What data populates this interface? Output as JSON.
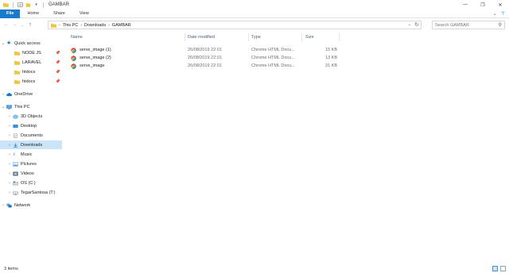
{
  "window": {
    "title": "GAMBAR",
    "controls": [
      "—",
      "❐",
      "✕"
    ]
  },
  "ribbon": {
    "tabs": [
      "File",
      "Home",
      "Share",
      "View"
    ],
    "expand_glyph": "⌄",
    "help_glyph": "?"
  },
  "address": {
    "crumbs": [
      "This PC",
      "Downloads",
      "GAMBAR"
    ],
    "separator": "›",
    "search_placeholder": "Search GAMBAR"
  },
  "nav": {
    "quick_access": "Quick access",
    "quick_items": [
      "NODE JS",
      "LARAVEL",
      "htdocs",
      "htdocs"
    ],
    "onedrive": "OneDrive",
    "this_pc": "This PC",
    "pc_items": [
      "3D Objects",
      "Desktop",
      "Documents",
      "Downloads",
      "Music",
      "Pictures",
      "Videos",
      "OS (C:)",
      "TegarSantosa (T:)"
    ],
    "network": "Network",
    "selected": "Downloads"
  },
  "columns": {
    "name": "Name",
    "date": "Date modified",
    "type": "Type",
    "size": "Size"
  },
  "files": [
    {
      "name": "serve_image (1)",
      "date": "26/08/2019 22:01",
      "type": "Chrome HTML Docu...",
      "size": "15 KB"
    },
    {
      "name": "serve_image (2)",
      "date": "26/08/2019 22:01",
      "type": "Chrome HTML Docu...",
      "size": "13 KB"
    },
    {
      "name": "serve_image",
      "date": "26/08/2019 22:01",
      "type": "Chrome HTML Docu...",
      "size": "31 KB"
    }
  ],
  "status": {
    "item_count": "3 items"
  },
  "colors": {
    "accent": "#1979ca",
    "selection": "#cce4f7",
    "folder": "#f0c543",
    "header_text": "#4c607a"
  }
}
